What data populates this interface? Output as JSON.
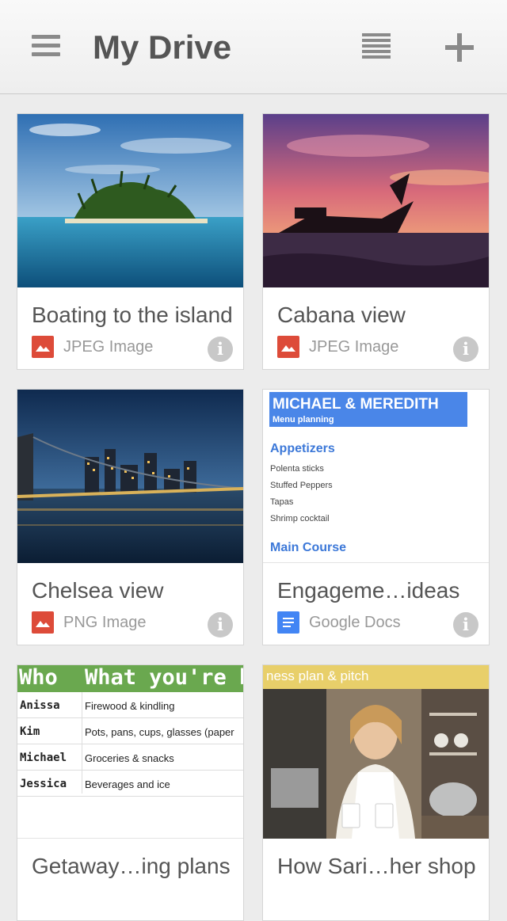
{
  "header": {
    "title": "My Drive"
  },
  "cards": [
    {
      "title": "Boating to the island",
      "type": "JPEG Image",
      "type_icon": "image-icon"
    },
    {
      "title": "Cabana view",
      "type": "JPEG Image",
      "type_icon": "image-icon"
    },
    {
      "title": "Chelsea view",
      "type": "PNG Image",
      "type_icon": "image-icon"
    },
    {
      "title": "Engageme…ideas",
      "type": "Google Docs",
      "type_icon": "docs-icon",
      "preview": {
        "banner_title": "MICHAEL & MEREDITH",
        "banner_subtitle": "Menu planning",
        "section1": "Appetizers",
        "items": [
          "Polenta sticks",
          "Stuffed Peppers",
          "Tapas",
          "Shrimp cocktail"
        ],
        "section2": "Main Course"
      }
    },
    {
      "title": "Getaway…ing plans",
      "preview": {
        "col1_header": "Who",
        "col2_header": "What you're b",
        "rows": [
          [
            "Anissa",
            "Firewood & kindling"
          ],
          [
            "Kim",
            "Pots, pans, cups, glasses (paper"
          ],
          [
            "Michael",
            "Groceries & snacks"
          ],
          [
            "Jessica",
            "Beverages and ice"
          ]
        ]
      }
    },
    {
      "title": "How Sari…her shop",
      "preview": {
        "overlay_text": "ness plan & pitch"
      }
    }
  ],
  "colors": {
    "image_icon": "#dd4b39",
    "docs_icon": "#4285f4",
    "sheet_header": "#6aa84f",
    "doc_banner": "#4a86e8"
  }
}
